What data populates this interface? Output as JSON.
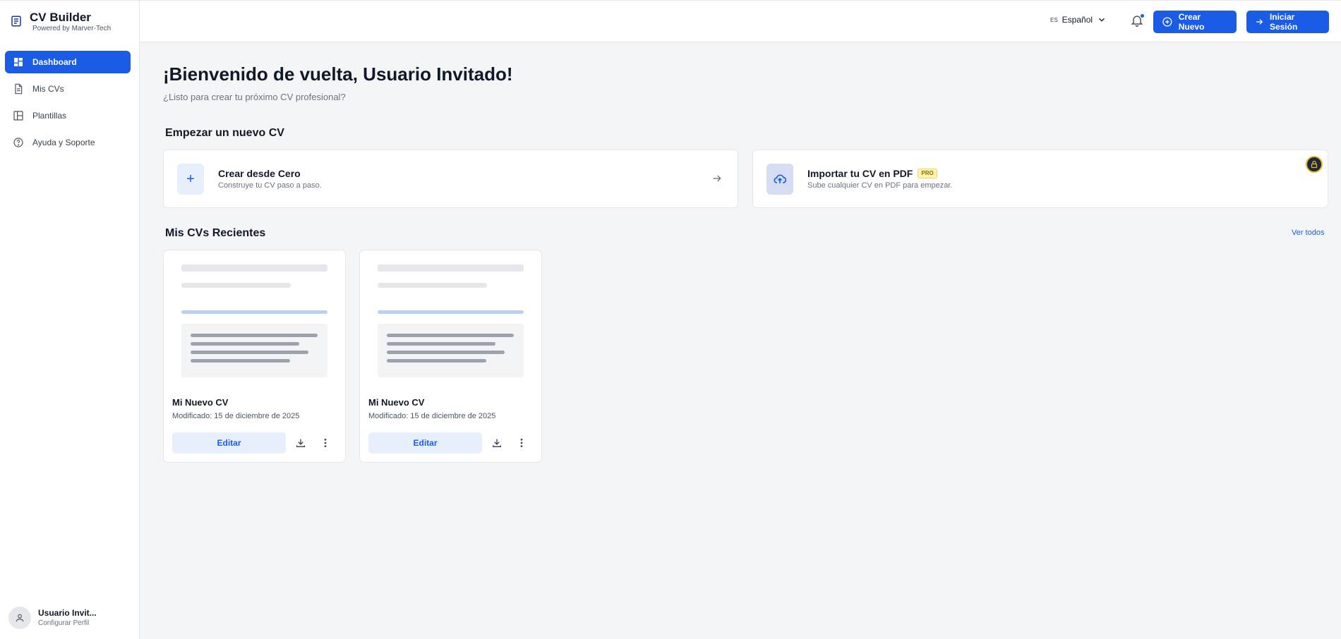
{
  "brand": {
    "title": "CV Builder",
    "subtitle": "Powered by Marver-Tech"
  },
  "sidebar": {
    "items": [
      {
        "label": "Dashboard",
        "icon": "dashboard-icon",
        "active": true
      },
      {
        "label": "Mis CVs",
        "icon": "document-icon"
      },
      {
        "label": "Plantillas",
        "icon": "layout-icon"
      },
      {
        "label": "Ayuda y Soporte",
        "icon": "help-icon"
      }
    ],
    "user": {
      "name": "Usuario Invit...",
      "subtitle": "Configurar Perfil"
    }
  },
  "topbar": {
    "language_code": "ES",
    "language": "Español",
    "create_label": "Crear Nuevo",
    "login_label": "Iniciar Sesión"
  },
  "main": {
    "welcome": "¡Bienvenido de vuelta, Usuario Invitado!",
    "welcome_sub": "¿Listo para crear tu próximo CV profesional?",
    "new_section_title": "Empezar un nuevo CV",
    "create_card": {
      "title": "Crear desde Cero",
      "desc": "Construye tu CV paso a paso."
    },
    "import_card": {
      "title": "Importar tu CV en PDF",
      "badge": "PRO",
      "desc": "Sube cualquier CV en PDF para empezar."
    },
    "recent_title": "Mis CVs Recientes",
    "view_all": "Ver todos",
    "cvs": [
      {
        "title": "Mi Nuevo CV",
        "meta": "Modificado: 15 de diciembre de 2025",
        "edit": "Editar"
      },
      {
        "title": "Mi Nuevo CV",
        "meta": "Modificado: 15 de diciembre de 2025",
        "edit": "Editar"
      }
    ]
  },
  "colors": {
    "accent": "#1a5ce6",
    "accent_soft": "#e8effc",
    "pro": "#fff3b0"
  }
}
